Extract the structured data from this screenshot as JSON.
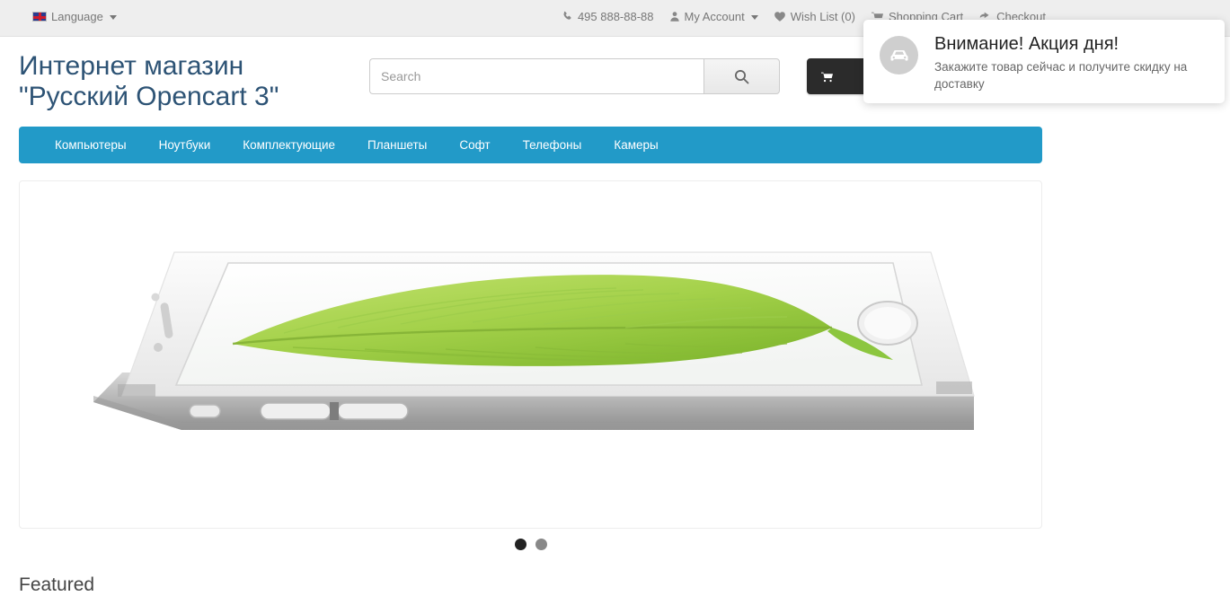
{
  "top_bar": {
    "language": {
      "label": "Language",
      "icon": "uk-flag-icon",
      "caret": "chevron-down-icon"
    },
    "links": [
      {
        "label": "495 888-88-88",
        "icon": "phone-icon"
      },
      {
        "label": "My Account",
        "icon": "user-icon",
        "caret": "chevron-down-icon"
      },
      {
        "label": "Wish List (0)",
        "icon": "heart-icon"
      },
      {
        "label": "Shopping Cart",
        "icon": "cart-icon"
      },
      {
        "label": "Checkout",
        "icon": "checkout-arrow-icon"
      }
    ]
  },
  "header": {
    "site_title": "Интернет магазин \"Русский Opencart 3\"",
    "search": {
      "placeholder": "Search",
      "value": "",
      "button_icon": "search-icon"
    },
    "cart_button": {
      "label": "",
      "icon": "cart-icon"
    }
  },
  "menu": {
    "items": [
      {
        "label": "Компьютеры"
      },
      {
        "label": "Ноутбуки"
      },
      {
        "label": "Комплектующие"
      },
      {
        "label": "Планшеты"
      },
      {
        "label": "Софт"
      },
      {
        "label": "Телефоны"
      },
      {
        "label": "Камеры"
      }
    ]
  },
  "carousel": {
    "slide_alt": "iphone-6-banner",
    "dots": [
      {
        "state": "active"
      },
      {
        "state": "idle"
      }
    ]
  },
  "featured": {
    "heading": "Featured"
  },
  "notification": {
    "icon": "car-delivery-icon",
    "title": "Внимание! Акция дня!",
    "body": "Закажите товар сейчас и получите скидку на доставку"
  },
  "colors": {
    "nav_blue": "#229ac8",
    "title_blue": "#2d5375",
    "top_bar_gray": "#eeeeee",
    "cart_dark": "#2b2b2b",
    "notif_circle": "#cfcfcf"
  }
}
